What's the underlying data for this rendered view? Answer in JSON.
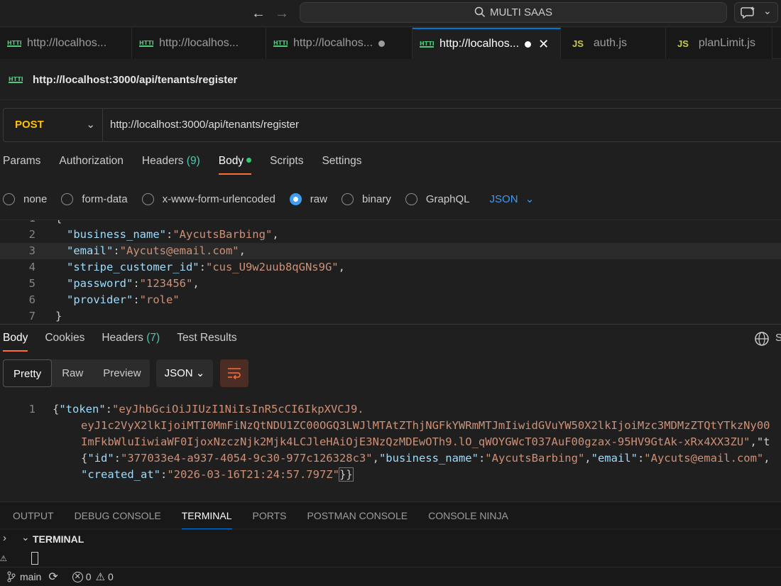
{
  "titlebar": {
    "search": "MULTI SAAS"
  },
  "tabs": [
    {
      "label": "http://localhos...",
      "type": "http",
      "dirty": false,
      "active": false
    },
    {
      "label": "http://localhos...",
      "type": "http",
      "dirty": false,
      "active": false
    },
    {
      "label": "http://localhos...",
      "type": "http",
      "dirty": true,
      "active": false
    },
    {
      "label": "http://localhos...",
      "type": "http",
      "dirty": true,
      "active": true
    },
    {
      "label": "auth.js",
      "type": "js",
      "dirty": false,
      "active": false
    },
    {
      "label": "planLimit.js",
      "type": "js",
      "dirty": false,
      "active": false
    }
  ],
  "request": {
    "title": "http://localhost:3000/api/tenants/register",
    "method": "POST",
    "url": "http://localhost:3000/api/tenants/register",
    "tabs": {
      "params": "Params",
      "authorization": "Authorization",
      "headers": "Headers",
      "headers_count": "(9)",
      "body": "Body",
      "scripts": "Scripts",
      "settings": "Settings"
    },
    "body_types": {
      "none": "none",
      "form_data": "form-data",
      "urlencoded": "x-www-form-urlencoded",
      "raw": "raw",
      "binary": "binary",
      "graphql": "GraphQL",
      "format": "JSON"
    },
    "body_lines": [
      {
        "num": "2",
        "key": "\"business_name\"",
        "value": "\"AycutsBarbing\"",
        "trail": ","
      },
      {
        "num": "3",
        "key": "\"email\"",
        "value": "\"Aycuts@email.com\"",
        "trail": ","
      },
      {
        "num": "4",
        "key": "\"stripe_customer_id\"",
        "value": "\"cus_U9w2uub8qGNs9G\"",
        "trail": ","
      },
      {
        "num": "5",
        "key": "\"password\"",
        "value": "\"123456\"",
        "trail": ","
      },
      {
        "num": "6",
        "key": "\"provider\"",
        "value": "\"role\"",
        "trail": ""
      }
    ],
    "partial_line_top": "1",
    "partial_line_bottom": "7"
  },
  "response": {
    "tabs": {
      "body": "Body",
      "cookies": "Cookies",
      "headers": "Headers",
      "headers_count": "(7)",
      "test_results": "Test Results"
    },
    "views": {
      "pretty": "Pretty",
      "raw": "Raw",
      "preview": "Preview"
    },
    "format": "JSON",
    "line_num": "1",
    "token_key": "\"token\"",
    "token_part1": "\"eyJhbGciOiJIUzI1NiIsInR5cCI6IkpXVCJ9.",
    "token_part2": "eyJ1c2VyX2lkIjoiMTI0MmFiNzQtNDU1ZC00OGQ3LWJlMTAtZThjNGFkYWRmMTJmIiwidGVuYW50X2lkIjoiMzc3MDMzZTQtYTkzNy00",
    "token_part3": "ImFkbWluIiwiaWF0IjoxNzczNjk2Mjk4LCJleHAiOjE3NzQzMDEwOTh9.lO_qWOYGWcT037AuF00gzax-95HV9GtAk-xRx4XX3ZU\"",
    "token_trail": ",\"t",
    "tenant_id_key": "\"id\"",
    "tenant_id_value": "\"377033e4-a937-4054-9c30-977c126328c3\"",
    "business_name_key": "\"business_name\"",
    "business_name_value": "\"AycutsBarbing\"",
    "email_key": "\"email\"",
    "email_value": "\"Aycuts@email.com\"",
    "created_at_key": "\"created_at\"",
    "created_at_value": "\"2026-03-16T21:24:57.797Z\"",
    "globe_label": "S"
  },
  "panel": {
    "tabs": [
      "OUTPUT",
      "DEBUG CONSOLE",
      "TERMINAL",
      "PORTS",
      "POSTMAN CONSOLE",
      "CONSOLE NINJA"
    ],
    "active_tab": "TERMINAL",
    "section_label": "TERMINAL"
  },
  "statusbar": {
    "branch": "main",
    "errors": "0",
    "warnings": "0"
  },
  "colors": {
    "accent": "#0078d4",
    "postman_orange": "#ff6c37",
    "method_post": "#ffc107",
    "json_key": "#9cdcfe",
    "json_string": "#ce9178"
  }
}
